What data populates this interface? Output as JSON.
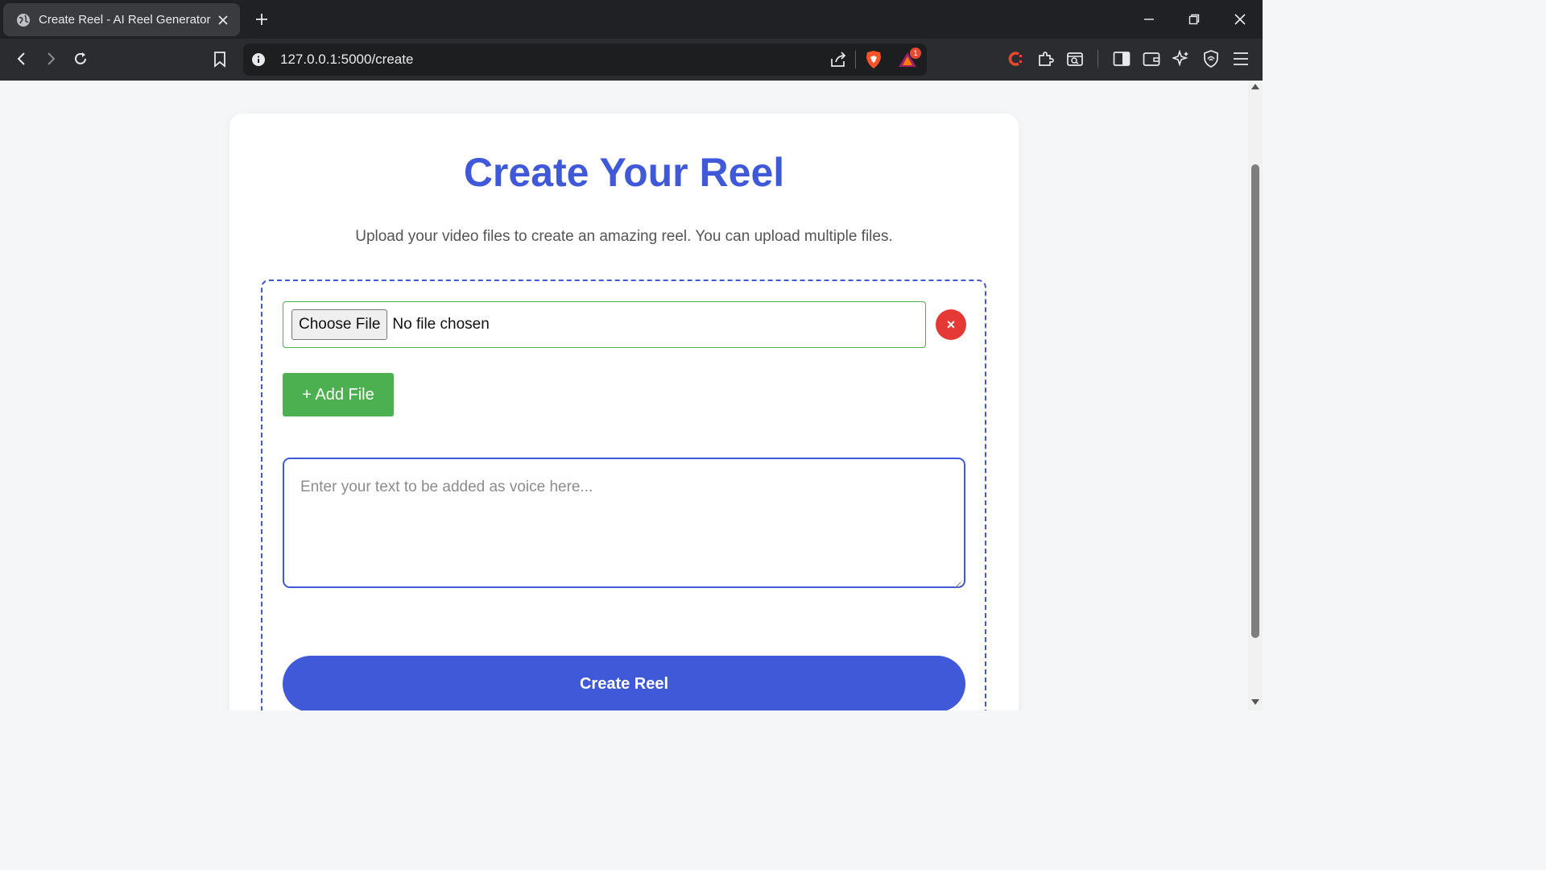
{
  "browser": {
    "tab_title": "Create Reel - AI Reel Generator",
    "url": "127.0.0.1:5000/create",
    "notification_count": "1"
  },
  "page": {
    "heading": "Create Your Reel",
    "subtitle": "Upload your video files to create an amazing reel. You can upload multiple files.",
    "file_input": {
      "button_label": "Choose File",
      "status": "No file chosen"
    },
    "remove_label": "×",
    "add_file_label": "+ Add File",
    "voice_placeholder": "Enter your text to be added as voice here...",
    "create_button_label": "Create Reel"
  },
  "colors": {
    "primary": "#4059d8",
    "success": "#4caf50",
    "danger": "#e53935"
  }
}
